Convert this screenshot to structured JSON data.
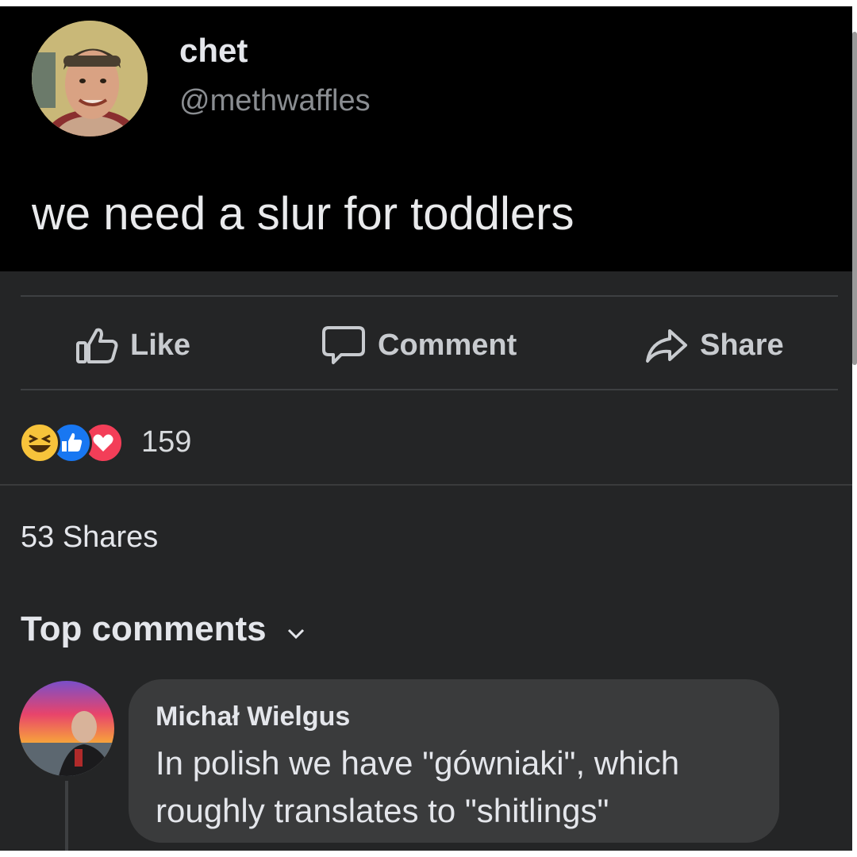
{
  "post": {
    "author_name": "chet",
    "author_handle": "@methwaffles",
    "text": "we need a slur for toddlers"
  },
  "actions": {
    "like_label": "Like",
    "comment_label": "Comment",
    "share_label": "Share"
  },
  "reactions": {
    "icons": [
      "haha-reaction-icon",
      "like-reaction-icon",
      "love-reaction-icon"
    ],
    "count": "159"
  },
  "shares": {
    "label": "53 Shares"
  },
  "comments": {
    "sort_label": "Top comments",
    "items": [
      {
        "author": "Michał Wielgus",
        "text": "In polish we have \"gówniaki\", which roughly translates to \"shitlings\""
      }
    ]
  },
  "colors": {
    "background": "#242526",
    "header_background": "#000000",
    "text_primary": "#e4e6eb",
    "text_secondary": "#8a8d91",
    "comment_bubble": "#3a3b3c",
    "like_blue": "#1877f2",
    "love_red": "#f33e58",
    "haha_yellow": "#f7c33b"
  }
}
